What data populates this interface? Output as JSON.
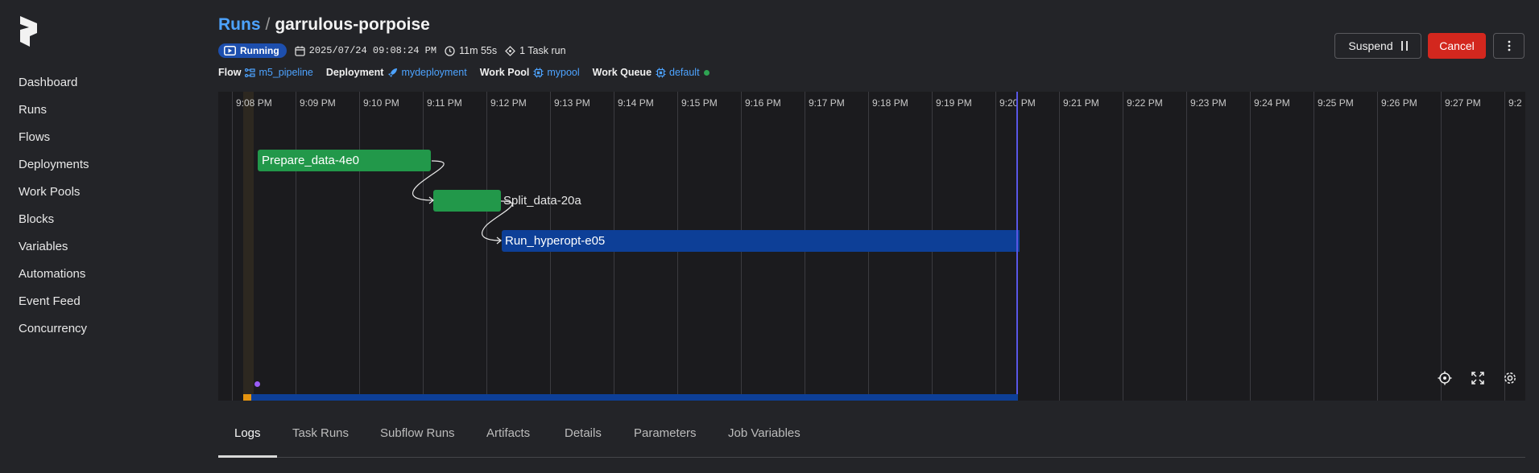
{
  "sidebar": {
    "items": [
      {
        "label": "Dashboard"
      },
      {
        "label": "Runs"
      },
      {
        "label": "Flows"
      },
      {
        "label": "Deployments"
      },
      {
        "label": "Work Pools"
      },
      {
        "label": "Blocks"
      },
      {
        "label": "Variables"
      },
      {
        "label": "Automations"
      },
      {
        "label": "Event Feed"
      },
      {
        "label": "Concurrency"
      }
    ]
  },
  "header": {
    "crumb": "Runs",
    "separator": "/",
    "run_name": "garrulous-porpoise",
    "state": "Running",
    "start_time": "2025/07/24 09:08:24 PM",
    "duration": "11m 55s",
    "task_runs": "1 Task run",
    "flow_key": "Flow",
    "flow_value": "m5_pipeline",
    "deployment_key": "Deployment",
    "deployment_value": "mydeployment",
    "work_pool_key": "Work Pool",
    "work_pool_value": "mypool",
    "work_queue_key": "Work Queue",
    "work_queue_value": "default"
  },
  "actions": {
    "suspend_label": "Suspend",
    "cancel_label": "Cancel"
  },
  "timeline": {
    "ticks": [
      "9:08 PM",
      "9:09 PM",
      "9:10 PM",
      "9:11 PM",
      "9:12 PM",
      "9:13 PM",
      "9:14 PM",
      "9:15 PM",
      "9:16 PM",
      "9:17 PM",
      "9:18 PM",
      "9:19 PM",
      "9:20 PM",
      "9:21 PM",
      "9:22 PM",
      "9:23 PM",
      "9:24 PM",
      "9:25 PM",
      "9:26 PM",
      "9:27 PM",
      "9:2"
    ],
    "tasks": [
      {
        "name": "Prepare_data-4e0",
        "color": "#22984a"
      },
      {
        "name": "Split_data-20a",
        "color": "#22984a"
      },
      {
        "name": "Run_hyperopt-e05",
        "color": "#0d3f97"
      }
    ]
  },
  "tabs": [
    {
      "label": "Logs"
    },
    {
      "label": "Task Runs"
    },
    {
      "label": "Subflow Runs"
    },
    {
      "label": "Artifacts"
    },
    {
      "label": "Details"
    },
    {
      "label": "Parameters"
    },
    {
      "label": "Job Variables"
    }
  ],
  "colors": {
    "accent": "#4da3ff",
    "running": "#1d4fae",
    "completed": "#22984a",
    "cancel": "#d3271e",
    "now_line": "#5856e6"
  }
}
